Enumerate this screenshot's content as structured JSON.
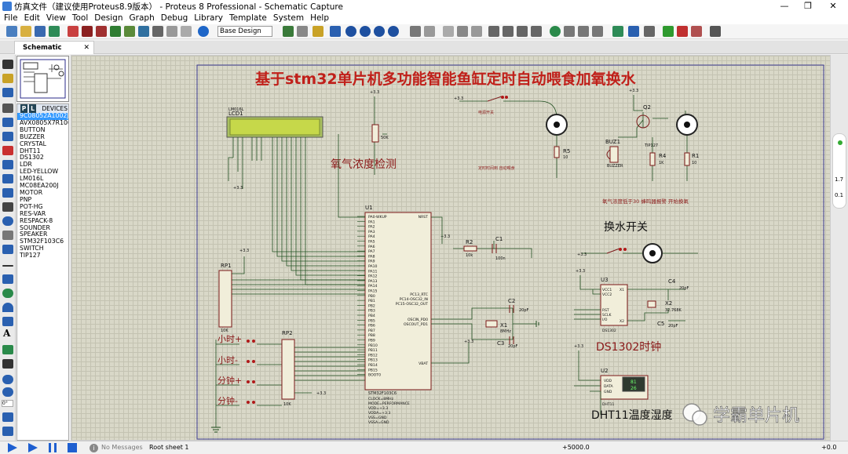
{
  "window": {
    "title": "仿真文件（建议使用Proteus8.9版本） - Proteus 8 Professional - Schematic Capture",
    "controls": [
      "—",
      "❐",
      "✕"
    ]
  },
  "menu": [
    "File",
    "Edit",
    "View",
    "Tool",
    "Design",
    "Graph",
    "Debug",
    "Library",
    "Template",
    "System",
    "Help"
  ],
  "toolbar": {
    "design_select": "Base Design"
  },
  "tab": {
    "label": "Schematic Capture",
    "close": "✕"
  },
  "device_panel": {
    "p_label": "P",
    "l_label": "L",
    "header": "DEVICES",
    "items": [
      "9C08052A1002JLH",
      "AVX0805X7R100N",
      "BUTTON",
      "BUZZER",
      "CRYSTAL",
      "DHT11",
      "DS1302",
      "LDR",
      "LED-YELLOW",
      "LM016L",
      "MC08EA200J",
      "MOTOR",
      "PNP",
      "POT-HG",
      "RES-VAR",
      "RESPACK-8",
      "SOUNDER",
      "SPEAKER",
      "STM32F103C6",
      "SWITCH",
      "TIP127"
    ],
    "selected": "9C08052A1002JLH"
  },
  "schematic": {
    "title": "基于stm32单片机多功能智能鱼缸定时自动喂食加氧换水",
    "lcd": {
      "ref": "LCD1",
      "part": "LM016L"
    },
    "o2_label": "氧气浓度检测",
    "power_label": "电源开关",
    "feed_label": "定时时间到 自动喂食",
    "alarm_label": "氧气浓度低于30 蜂鸣器报警 开始换氧",
    "water_label": "换水开关",
    "buz": {
      "ref": "BUZ1",
      "part": "BUZZER"
    },
    "q2": {
      "ref": "Q2",
      "part": "TIP127"
    },
    "r1": {
      "ref": "R1",
      "val": "10"
    },
    "r4": {
      "ref": "R4",
      "val": "1K"
    },
    "r5": {
      "ref": "R5",
      "val": "10"
    },
    "u1": {
      "ref": "U1",
      "part": "STM32F103C6",
      "info": [
        "CLOCK=8MHz",
        "MODE=PERFORMANCE",
        "VDD=+3.3",
        "VDDA=+3.3",
        "VSS=GND",
        "VSSA=GND"
      ]
    },
    "u1_left_pins": [
      "PA0-WKUP",
      "PA1",
      "PA2",
      "PA3",
      "PA4",
      "PA5",
      "PA6",
      "PA7",
      "PA8",
      "PA9",
      "PA10",
      "PA11",
      "PA12",
      "PA13",
      "PA14",
      "PA15",
      "PB0",
      "PB1",
      "PB2",
      "PB3",
      "PB4",
      "PB5",
      "PB6",
      "PB7",
      "PB8",
      "PB9",
      "PB10",
      "PB11",
      "PB12",
      "PB13",
      "PB14",
      "PB15",
      "BOOT0"
    ],
    "u1_right_pins": [
      "NRST",
      "PC13_RTC",
      "PC14-OSC32_IN",
      "PC15-OSC32_OUT",
      "OSCIN_PD0",
      "OSCOUT_PD1",
      "VBAT"
    ],
    "r2": {
      "ref": "R2",
      "val": "10k"
    },
    "c1": {
      "ref": "C1",
      "val": "100n"
    },
    "c2": {
      "ref": "C2",
      "val": "20pF"
    },
    "c3": {
      "ref": "C3",
      "val": "20pF"
    },
    "x1": {
      "ref": "X1",
      "val": "8MHz"
    },
    "rp1": {
      "ref": "RP1",
      "val": "10K"
    },
    "rp2": {
      "ref": "RP2",
      "val": "10K"
    },
    "buttons": [
      "小时+",
      "小时-",
      "分钟+",
      "分钟-"
    ],
    "u3": {
      "ref": "U3",
      "part": "DS1302",
      "pins": [
        "VCC1",
        "VCC2",
        "X1",
        "X2",
        "RST",
        "SCLK",
        "I/O"
      ]
    },
    "c4": {
      "ref": "C4",
      "val": "20pF"
    },
    "c5": {
      "ref": "C5",
      "val": "20pF"
    },
    "x2": {
      "ref": "X2",
      "val": "32.768K"
    },
    "ds1302_label": "DS1302时钟",
    "u2": {
      "ref": "U2",
      "part": "DHT11",
      "pins": [
        "VDD",
        "DATA",
        "GND"
      ],
      "disp1": "81",
      "disp2": "26"
    },
    "dht11_label": "DHT11温度湿度",
    "watermark": "学霸单片机",
    "pot": "50K",
    "v33": "+3.3"
  },
  "right_gauges": [
    "1.7",
    "0.1"
  ],
  "status": {
    "messages": "No Messages",
    "sheet": "Root sheet 1",
    "coord_x": "+5000.0",
    "coord_y": "+0.0"
  },
  "colors": {
    "wire": "#1e4d1e",
    "part_outline": "#7a1818",
    "part_fill": "#f1eeda",
    "title_red": "#c0201a",
    "grid_bg": "#d9d8c8",
    "sel_blue": "#3399ff"
  }
}
